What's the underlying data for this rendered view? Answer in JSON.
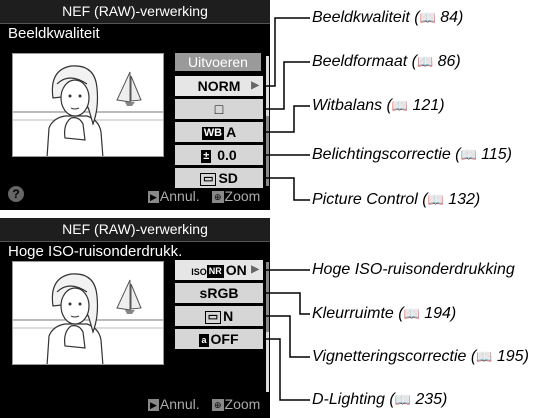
{
  "screen1": {
    "title": "NEF (RAW)-verwerking",
    "subtitle": "Beeldkwaliteit",
    "run": "Uitvoeren",
    "quality": "NORM",
    "size_icon": "□",
    "wb_icon": "WB",
    "wb_value": "A",
    "ev_icon": "±",
    "ev_value": "0.0",
    "pc_icon": "▭",
    "pc_value": "SD",
    "help": "?",
    "cancel_icon": "▶",
    "cancel": "Annul.",
    "zoom_icon": "⊕",
    "zoom": "Zoom"
  },
  "screen2": {
    "title": "NEF (RAW)-verwerking",
    "subtitle": "Hoge ISO-ruisonderdrukk.",
    "iso_icon": "ISO",
    "iso_nr": "NR",
    "iso_value": "ON",
    "color_space": "sRGB",
    "vign_icon": "▭",
    "vign_value": "N",
    "dl_icon": "a",
    "dl_value": "OFF",
    "cancel_icon": "▶",
    "cancel": "Annul.",
    "zoom_icon": "⊕",
    "zoom": "Zoom"
  },
  "callouts": {
    "bk_icon": "\u0000",
    "beeldkwaliteit": "Beeldkwaliteit (",
    "beeldkwaliteit_page": " 84)",
    "beeldformaat": "Beeldformaat (",
    "beeldformaat_page": " 86)",
    "witbalans": "Witbalans (",
    "witbalans_page": " 121)",
    "belichting": "Belichtingscorrectie (",
    "belichting_page": " 115)",
    "picture": "Picture Control (",
    "picture_page": " 132)",
    "iso": "Hoge ISO-ruisonderdrukking",
    "kleur": "Kleurruimte (",
    "kleur_page": " 194)",
    "vignet": "Vignetteringscorrectie (",
    "vignet_page": " 195)",
    "dlighting": "D-Lighting (",
    "dlighting_page": " 235)"
  },
  "colors": {
    "menu_bg": "#d6d6d6",
    "run_bg": "#9a9a9a",
    "screen_bg": "#000000"
  }
}
